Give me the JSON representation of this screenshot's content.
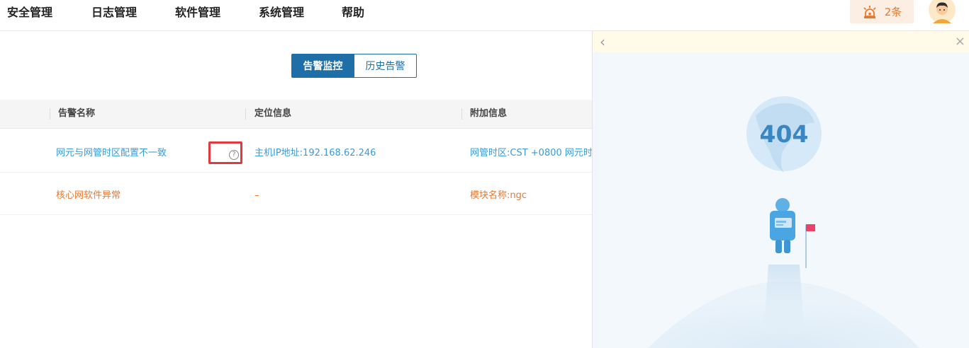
{
  "nav": {
    "items": [
      "安全管理",
      "日志管理",
      "软件管理",
      "系统管理",
      "帮助"
    ]
  },
  "alarm": {
    "count_label": "2条",
    "icon": "alarm-light-icon",
    "color": "#e8782e"
  },
  "avatar": {
    "icon": "user-avatar-icon"
  },
  "tabs": {
    "active": "告警监控",
    "inactive": "历史告警"
  },
  "table": {
    "headers": [
      "告警名称",
      "定位信息",
      "附加信息"
    ],
    "rows": [
      {
        "name": "网元与网管时区配置不一致",
        "location": "主机IP地址:192.168.62.246",
        "extra": "网管时区:CST +0800 网元时",
        "color": "#3a9ad9",
        "has_help": true
      },
      {
        "name": "核心网软件异常",
        "location": "–",
        "extra": "模块名称:ngc",
        "color": "#e8782e",
        "has_help": false
      }
    ]
  },
  "panel": {
    "error_code": "404",
    "back_icon": "chevron-left-icon",
    "close_icon": "close-icon"
  },
  "colors": {
    "primary": "#1e6ea8",
    "link_blue": "#3a9ad9",
    "warning_orange": "#e8782e",
    "highlight_red": "#e0393e"
  }
}
